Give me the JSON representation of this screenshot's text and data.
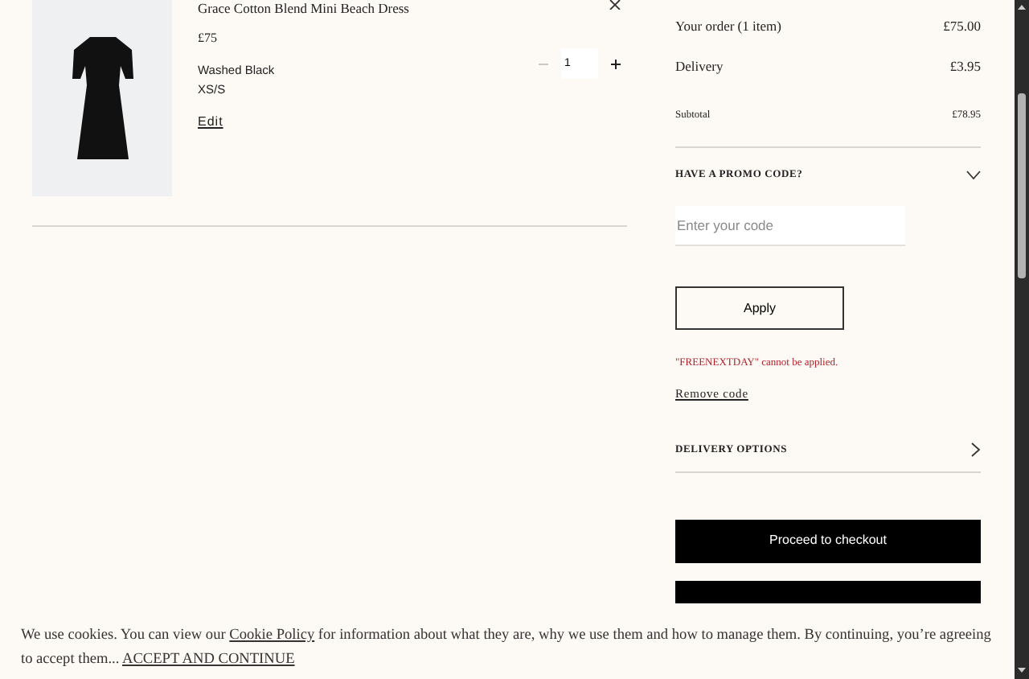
{
  "cart_item": {
    "title": "Grace Cotton Blend Mini Beach Dress",
    "price": "£75",
    "colour": "Washed Black",
    "size": "XS/S",
    "edit_link": "Edit",
    "quantity": "1",
    "minus_disabled": true
  },
  "summary": {
    "lines": [
      {
        "label": "Your order (1 item)",
        "value": "£75.00"
      },
      {
        "label": "Delivery",
        "value": "£3.95"
      }
    ],
    "subtotal": {
      "label": "Subtotal",
      "value": "£78.95"
    }
  },
  "promo": {
    "heading": "HAVE A PROMO CODE?",
    "expanded": true,
    "placeholder": "Enter your code",
    "apply_button": "Apply",
    "error": "\"FREENEXTDAY\" cannot be applied.",
    "remove_link": "Remove code"
  },
  "delivery_options": {
    "heading": "DELIVERY OPTIONS",
    "expanded": false
  },
  "checkout_button": "Proceed to checkout",
  "cookie_banner": {
    "text_before": "We use cookies. You can view our",
    "policy_link": "Cookie Policy",
    "text_after": "for information about what they are, why we use them and how to manage them. By continuing, you’re agreeing to accept them...",
    "accept_link": "ACCEPT AND CONTINUE"
  }
}
